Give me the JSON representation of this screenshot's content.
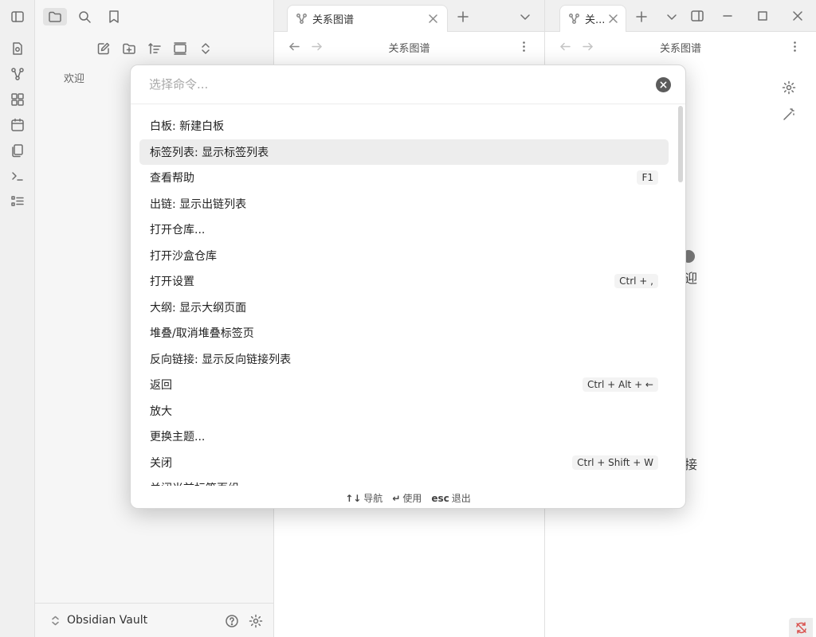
{
  "sidebar": {
    "file_welcome": "欢迎",
    "vault_name": "Obsidian Vault"
  },
  "tabs": {
    "center_tab_title": "关系图谱",
    "right_tab_title": "关..."
  },
  "panes": {
    "center_header": "关系图谱",
    "right_header": "关系图谱",
    "graph_node_welcome": "迎",
    "graph_node_link": "接"
  },
  "command_palette": {
    "placeholder": "选择命令...",
    "commands": [
      {
        "label": "白板: 新建白板",
        "hotkey": ""
      },
      {
        "label": "标签列表: 显示标签列表",
        "hotkey": ""
      },
      {
        "label": "查看帮助",
        "hotkey": "F1"
      },
      {
        "label": "出链: 显示出链列表",
        "hotkey": ""
      },
      {
        "label": "打开仓库...",
        "hotkey": ""
      },
      {
        "label": "打开沙盒仓库",
        "hotkey": ""
      },
      {
        "label": "打开设置",
        "hotkey": "Ctrl + ,"
      },
      {
        "label": "大纲: 显示大纲页面",
        "hotkey": ""
      },
      {
        "label": "堆叠/取消堆叠标签页",
        "hotkey": ""
      },
      {
        "label": "反向链接: 显示反向链接列表",
        "hotkey": ""
      },
      {
        "label": "返回",
        "hotkey": "Ctrl + Alt + ←"
      },
      {
        "label": "放大",
        "hotkey": ""
      },
      {
        "label": "更换主题...",
        "hotkey": ""
      },
      {
        "label": "关闭",
        "hotkey": "Ctrl + Shift + W"
      },
      {
        "label": "关闭当前标签页组",
        "hotkey": ""
      }
    ],
    "selected_index": 1,
    "footer": {
      "navigate_key": "↑↓",
      "navigate_label": "导航",
      "use_key": "↵",
      "use_label": "使用",
      "exit_key": "esc",
      "exit_label": "退出"
    }
  }
}
